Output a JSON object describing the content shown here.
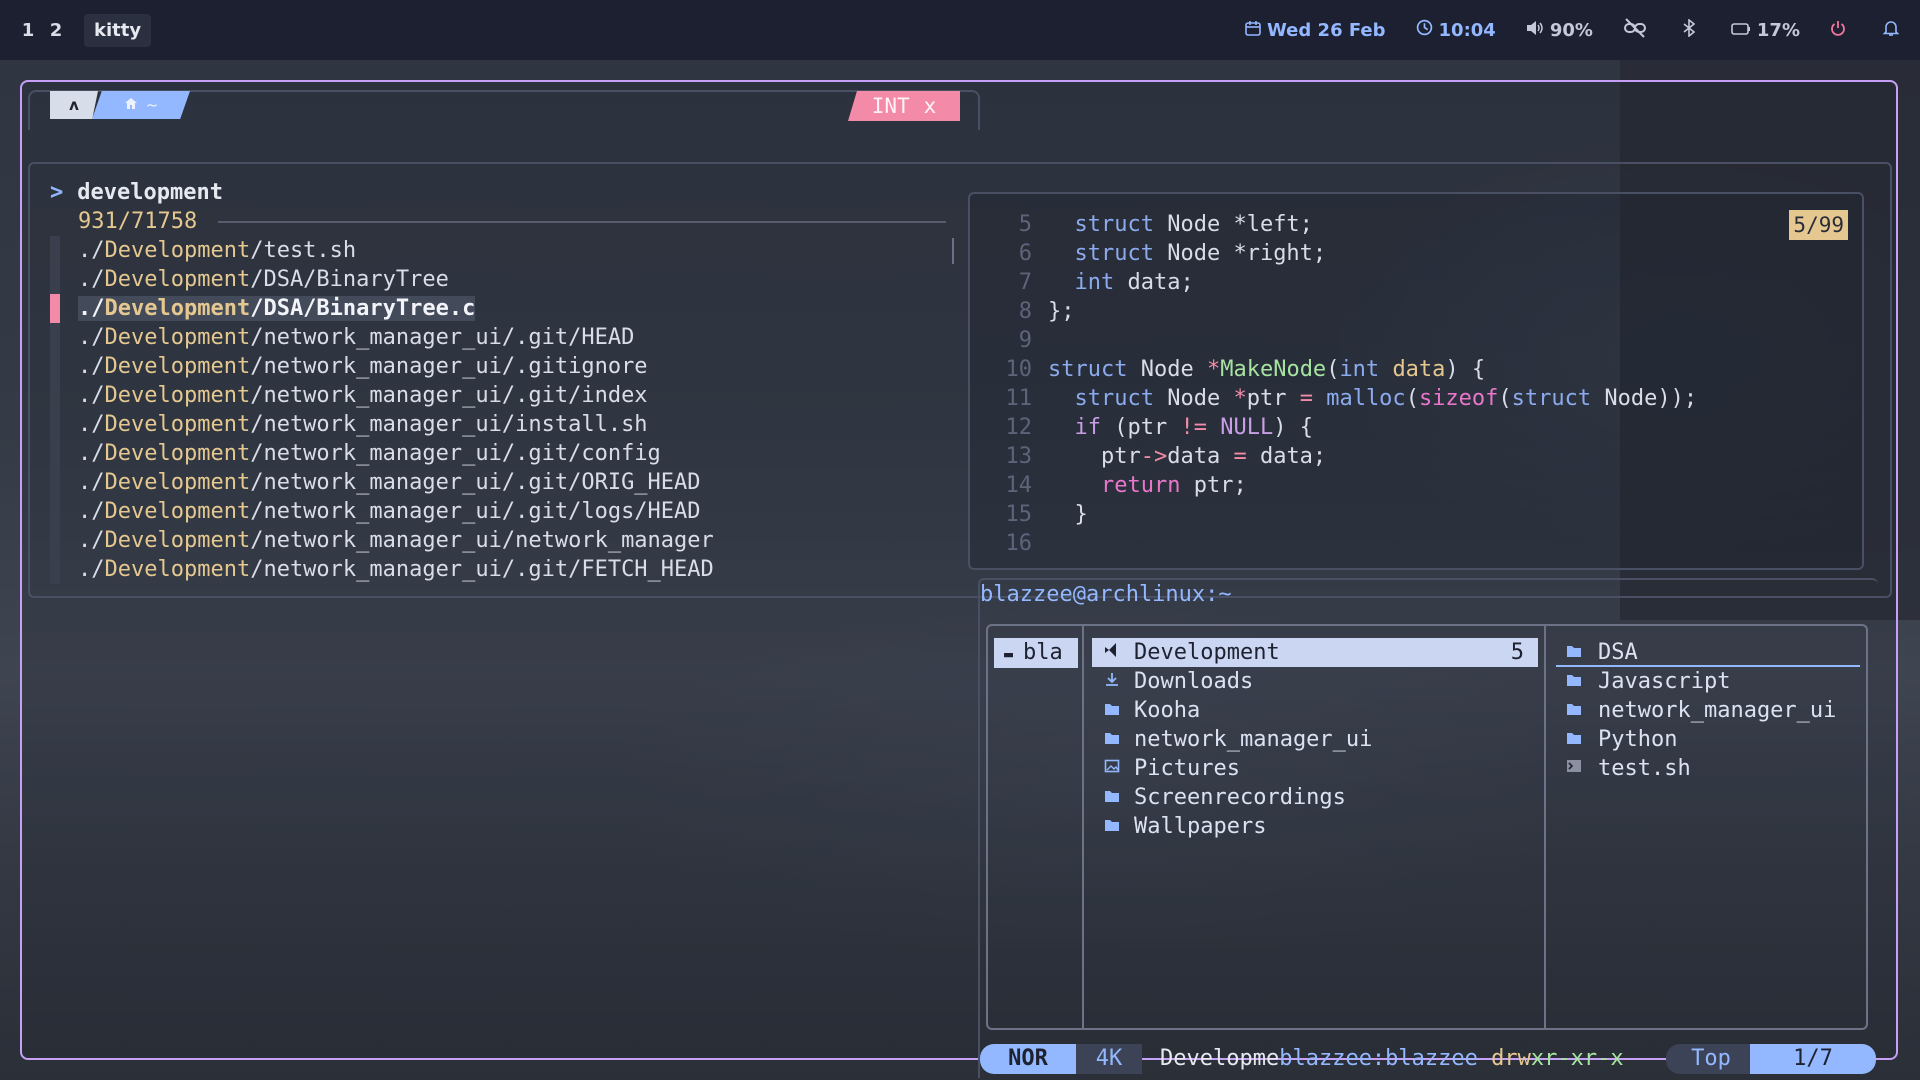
{
  "topbar": {
    "workspaces": [
      "1",
      "2"
    ],
    "window_title": "kitty",
    "date": "Wed 26 Feb",
    "time": "10:04",
    "volume": "90%",
    "battery": "17%"
  },
  "prompt": {
    "arch_glyph": "ʌ",
    "home": "~",
    "mode": "INT",
    "mode_close": "x"
  },
  "fzf": {
    "caret": ">",
    "query": "development",
    "count": "931/71758",
    "items": [
      {
        "pre": "./",
        "dev": "Development",
        "rest": "/test.sh"
      },
      {
        "pre": "./",
        "dev": "Development",
        "rest": "/DSA/BinaryTree"
      },
      {
        "pre": "./",
        "dev": "Development",
        "rest": "/DSA/BinaryTree.c"
      },
      {
        "pre": "./",
        "dev": "Development",
        "rest": "/network_manager_ui/.git/HEAD"
      },
      {
        "pre": "./",
        "dev": "Development",
        "rest": "/network_manager_ui/.gitignore"
      },
      {
        "pre": "./",
        "dev": "Development",
        "rest": "/network_manager_ui/.git/index"
      },
      {
        "pre": "./",
        "dev": "Development",
        "rest": "/network_manager_ui/install.sh"
      },
      {
        "pre": "./",
        "dev": "Development",
        "rest": "/network_manager_ui/.git/config"
      },
      {
        "pre": "./",
        "dev": "Development",
        "rest": "/network_manager_ui/.git/ORIG_HEAD"
      },
      {
        "pre": "./",
        "dev": "Development",
        "rest": "/network_manager_ui/.git/logs/HEAD"
      },
      {
        "pre": "./",
        "dev": "Development",
        "rest": "/network_manager_ui/network_manager"
      },
      {
        "pre": "./",
        "dev": "Development",
        "rest": "/network_manager_ui/.git/FETCH_HEAD"
      }
    ],
    "selected_index": 2
  },
  "preview": {
    "position": "5/99",
    "line_numbers": [
      "5",
      "6",
      "7",
      "8",
      "9",
      "10",
      "11",
      "12",
      "13",
      "14",
      "15",
      "16"
    ]
  },
  "yazi": {
    "title": "blazzee@archlinux:~",
    "parent": "bla",
    "current": [
      {
        "name": "Development",
        "count": "5",
        "icon": "vscode-icon"
      },
      {
        "name": "Downloads",
        "count": "",
        "icon": "download-folder-icon"
      },
      {
        "name": "Kooha",
        "count": "",
        "icon": "folder-icon"
      },
      {
        "name": "network_manager_ui",
        "count": "",
        "icon": "folder-icon"
      },
      {
        "name": "Pictures",
        "count": "",
        "icon": "pictures-folder-icon"
      },
      {
        "name": "Screenrecordings",
        "count": "",
        "icon": "folder-icon"
      },
      {
        "name": "Wallpapers",
        "count": "",
        "icon": "folder-icon"
      }
    ],
    "preview": [
      {
        "name": "DSA",
        "icon": "folder-icon"
      },
      {
        "name": "Javascript",
        "icon": "folder-icon"
      },
      {
        "name": "network_manager_ui",
        "icon": "folder-icon"
      },
      {
        "name": "Python",
        "icon": "folder-icon"
      },
      {
        "name": "test.sh",
        "icon": "terminal-file-icon"
      }
    ],
    "status": {
      "mode": "NOR",
      "size": "4K",
      "filename": "Developme",
      "owner": "blazzee:blazzee",
      "perm_prefix": "drw",
      "perm_rest": "xr-xr-x",
      "scroll": "Top",
      "position": "1/7"
    }
  },
  "colors": {
    "accent": "#93b8ff",
    "border": "#c6a0f6",
    "pink": "#f38ba8",
    "yellow": "#e5c890",
    "green": "#a6e3a1"
  }
}
